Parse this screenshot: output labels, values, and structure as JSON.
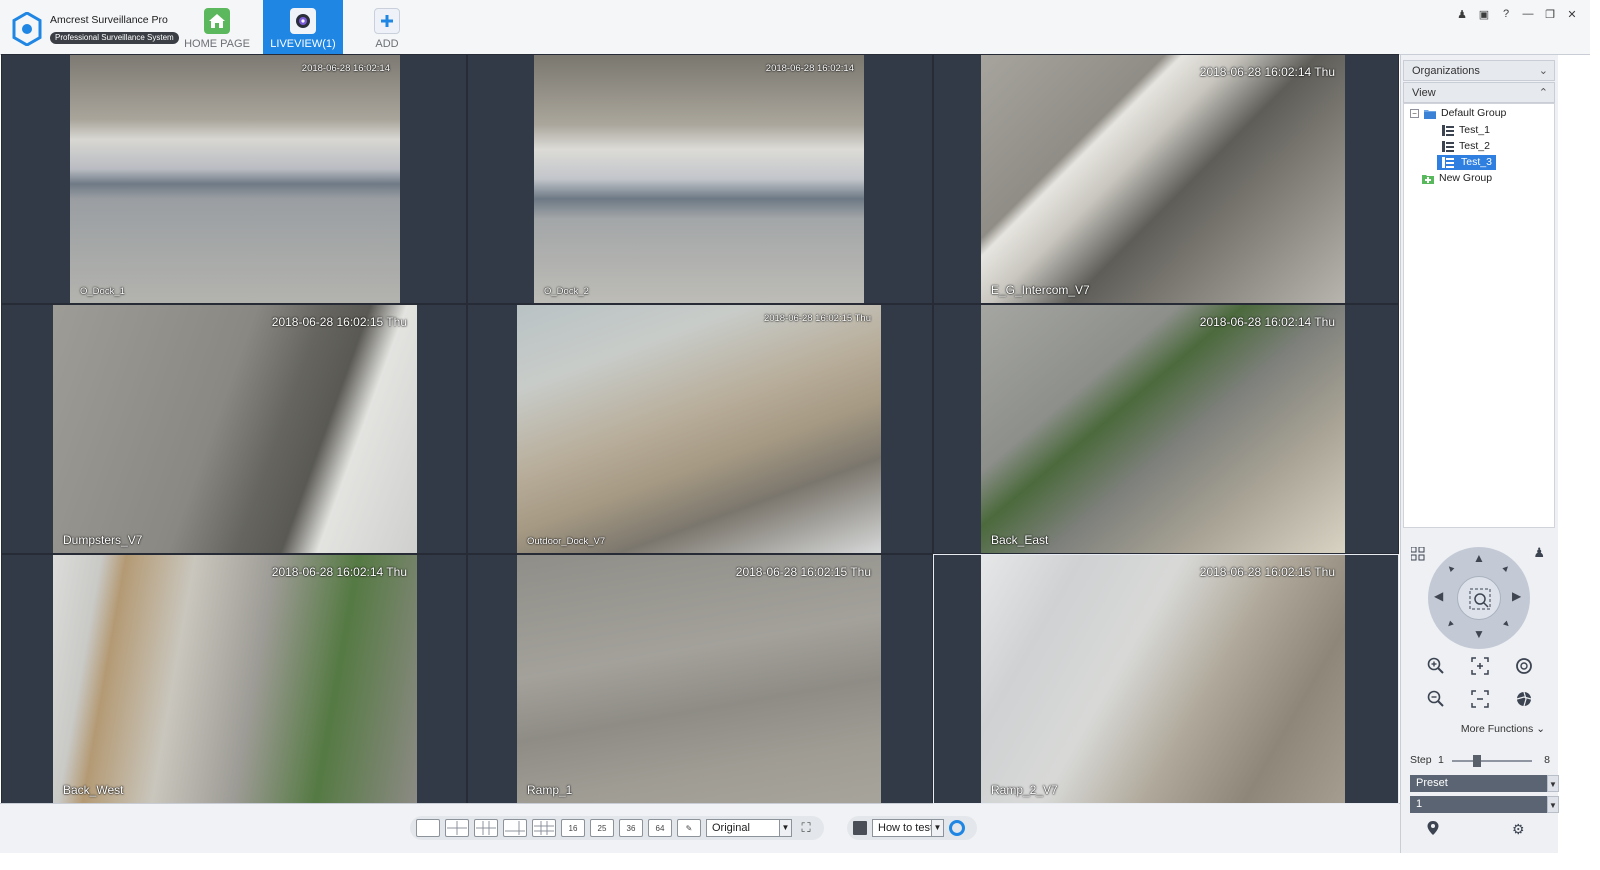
{
  "app": {
    "name": "Amcrest Surveillance Pro",
    "subtitle": "Professional Surveillance System"
  },
  "nav": {
    "home_label": "HOME PAGE",
    "liveview_label": "LIVEVIEW(1)",
    "add_label": "ADD"
  },
  "cameras": [
    {
      "name": "O_Dock_1",
      "timestamp": "2018-06-28 16:02:14"
    },
    {
      "name": "O_Dock_2",
      "timestamp": "2018-06-28 16:02:14"
    },
    {
      "name": "E_G_Intercom_V7",
      "timestamp": "2018-06-28 16:02:14 Thu"
    },
    {
      "name": "Dumpsters_V7",
      "timestamp": "2018-06-28 16:02:15 Thu"
    },
    {
      "name": "Outdoor_Dock_V7",
      "timestamp": "2018-06-28 16:02:15 Thu"
    },
    {
      "name": "Back_East",
      "timestamp": "2018-06-28 16:02:14 Thu"
    },
    {
      "name": "Back_West",
      "timestamp": "2018-06-28 16:02:14 Thu"
    },
    {
      "name": "Ramp_1",
      "timestamp": "2018-06-28 16:02:15 Thu"
    },
    {
      "name": "Ramp_2_V7",
      "timestamp": "2018-06-28 16:02:15 Thu"
    }
  ],
  "toolbar": {
    "layout_16": "16",
    "layout_25": "25",
    "layout_36": "36",
    "layout_64": "64",
    "ratio": "Original",
    "how_to_test": "How to test"
  },
  "panel": {
    "organizations": "Organizations",
    "view": "View",
    "tree": {
      "group": "Default Group",
      "items": [
        "Test_1",
        "Test_2",
        "Test_3"
      ],
      "selected": "Test_3",
      "new_group": "New Group"
    },
    "more_functions": "More Functions",
    "step_label": "Step",
    "step_min": "1",
    "step_max": "8",
    "step_value": 3,
    "preset_label": "Preset",
    "preset_value": "1"
  },
  "colors": {
    "accent": "#1f86e3",
    "grid_bg": "#323845",
    "tree_selected": "#2e7fe0"
  }
}
